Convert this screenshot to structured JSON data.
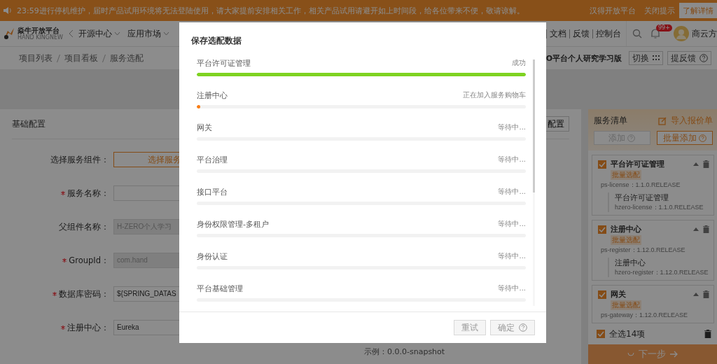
{
  "banner": {
    "message": "23:59进行停机维护，届时产品试用环境将无法登陆使用，请大家提前安排相关工作，相关产品试用请避开如上时间段，给各位带来不便，敬请谅解。",
    "site": "汉得开放平台",
    "close": "关闭提示",
    "details": "了解详情"
  },
  "header": {
    "logo_title": "焱牛开放平台",
    "logo_subtitle": "HAND KINGNEW",
    "nav": [
      {
        "label": "开源中心",
        "dropdown": true
      },
      {
        "label": "应用市场",
        "dropdown": true
      }
    ],
    "links": [
      "文档",
      "反馈",
      "控制台"
    ],
    "badge": "99+",
    "user": "商云方"
  },
  "breadcrumb": [
    "项目列表",
    "项目看板",
    "服务选配"
  ],
  "project": {
    "name": "O平台个人研究学习版",
    "switch": "切换",
    "feedback": "提反馈"
  },
  "config": {
    "title": "基础配置",
    "action": "配置",
    "fields": [
      {
        "label": "选择服务组件：",
        "required": false,
        "kind": "button",
        "value": "选择服务",
        "disabled": false
      },
      {
        "label": "服务名称：",
        "required": true,
        "kind": "input",
        "disabled": false
      },
      {
        "label": "父组件名称：",
        "required": false,
        "kind": "input",
        "value": "H-ZERO个人学习",
        "disabled": true
      },
      {
        "label": "GroupId：",
        "required": true,
        "kind": "input",
        "value": "com.hand",
        "disabled": true
      },
      {
        "label": "数据库密码：",
        "required": true,
        "kind": "input",
        "value": "${SPRING_DATAS",
        "disabled": false
      },
      {
        "label": "注册中心：",
        "required": true,
        "kind": "input",
        "value": "Eureka",
        "disabled": false
      }
    ],
    "hint": "示例：0.0.0-snapshot"
  },
  "cart": {
    "title": "服务清单",
    "import": "导入报价单",
    "add": "添加",
    "batch_add": "批量添加",
    "items": [
      {
        "name": "平台许可证管理",
        "checked": true,
        "tag": "批量选配",
        "artifact": "ps-license：1.1.0.RELEASE",
        "children": [
          {
            "name": "平台许可证管理",
            "artifact": "hzero-license：1.1.0.RELEASE"
          }
        ]
      },
      {
        "name": "注册中心",
        "checked": true,
        "tag": "批量选配",
        "artifact": "ps-register：1.12.0.RELEASE",
        "children": [
          {
            "name": "注册中心",
            "artifact": "hzero-register：1.12.0.RELEASE"
          }
        ]
      },
      {
        "name": "网关",
        "checked": true,
        "tag": "批量选配",
        "artifact": "ps-gateway：1.12.0.RELEASE"
      }
    ],
    "select_all": {
      "label": "全选14项",
      "checked": true
    },
    "next": "下一步"
  },
  "modal": {
    "title": "保存选配数据",
    "tasks": [
      {
        "name": "平台许可证管理",
        "status": "成功",
        "kind": "success",
        "level": 1
      },
      {
        "name": "注册中心",
        "status": "正在加入服务购物车",
        "kind": "active",
        "level": 0.01
      },
      {
        "name": "网关",
        "status": "等待中...",
        "kind": "waiting",
        "level": 0
      },
      {
        "name": "平台治理",
        "status": "等待中...",
        "kind": "waiting",
        "level": 0
      },
      {
        "name": "接口平台",
        "status": "等待中...",
        "kind": "waiting",
        "level": 0
      },
      {
        "name": "身份权限管理-多租户",
        "status": "等待中...",
        "kind": "waiting",
        "level": 0
      },
      {
        "name": "身份认证",
        "status": "等待中...",
        "kind": "waiting",
        "level": 0
      },
      {
        "name": "平台基础管理",
        "status": "等待中...",
        "kind": "waiting",
        "level": 0
      }
    ],
    "buttons": [
      {
        "label": "重试",
        "disabled": true,
        "help": false
      },
      {
        "label": "确定",
        "disabled": true,
        "help": true
      }
    ]
  }
}
